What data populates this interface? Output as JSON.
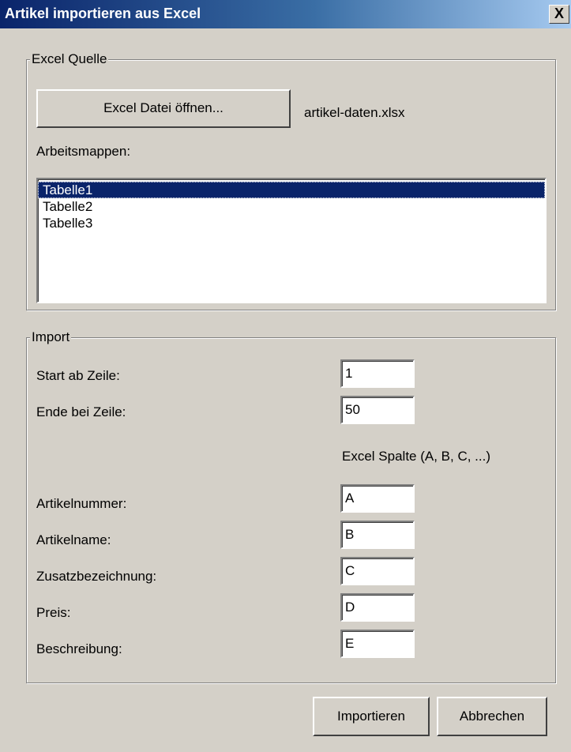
{
  "window": {
    "title": "Artikel importieren aus Excel",
    "close_icon": "close-icon",
    "close_glyph": "X"
  },
  "excel_source": {
    "group_label": "Excel Quelle",
    "open_button_label": "Excel Datei öffnen...",
    "file_name": "artikel-daten.xlsx",
    "sheets_label": "Arbeitsmappen:",
    "sheets": [
      "Tabelle1",
      "Tabelle2",
      "Tabelle3"
    ],
    "selected_sheet": "Tabelle1"
  },
  "import": {
    "group_label": "Import",
    "start_row_label": "Start ab Zeile:",
    "start_row_value": "1",
    "end_row_label": "Ende bei Zeile:",
    "end_row_value": "50",
    "column_header": "Excel Spalte (A, B, C, ...)",
    "fields": [
      {
        "label": "Artikelnummer:",
        "value": "A"
      },
      {
        "label": "Artikelname:",
        "value": "B"
      },
      {
        "label": "Zusatzbezeichnung:",
        "value": "C"
      },
      {
        "label": "Preis:",
        "value": "D"
      },
      {
        "label": "Beschreibung:",
        "value": "E"
      }
    ]
  },
  "buttons": {
    "import_label": "Importieren",
    "cancel_label": "Abbrechen"
  }
}
